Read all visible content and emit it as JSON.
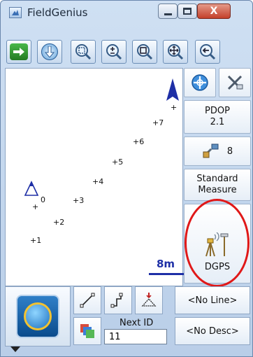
{
  "window": {
    "title": "FieldGenius",
    "close_glyph": "X"
  },
  "toolbar": {
    "icons": [
      "exit-arrow-icon",
      "measure-down-icon",
      "zoom-window-icon",
      "zoom-in-out-icon",
      "zoom-extents-icon",
      "pan-icon",
      "previous-view-icon"
    ]
  },
  "map": {
    "points": [
      "1",
      "2",
      "3",
      "4",
      "5",
      "6",
      "7"
    ],
    "control_point_label": "0",
    "scale_label": "8m",
    "colors": {
      "triangle": "#1e2fa6",
      "scale": "#1e2fa6"
    }
  },
  "side": {
    "pdop_label": "PDOP",
    "pdop_value": "2.1",
    "satellites": "8",
    "mode_line1": "Standard",
    "mode_line2": "Measure",
    "gps_label": "DGPS"
  },
  "bottom": {
    "line_button": "<No Line>",
    "desc_button": "<No Desc>",
    "next_id_label": "Next ID",
    "next_id_value": "11"
  },
  "highlight_color": "#e01818"
}
